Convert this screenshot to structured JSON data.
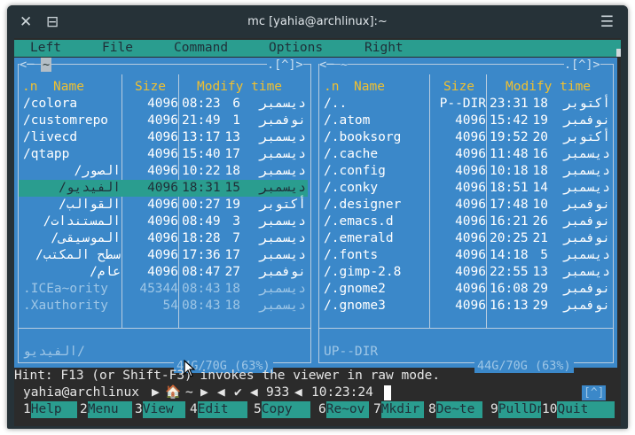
{
  "window": {
    "title": "mc [yahia@archlinux]:~"
  },
  "menu": [
    "Left",
    "File",
    "Command",
    "Options",
    "Right"
  ],
  "left_panel": {
    "path": "~",
    "top_right": ".[^]>",
    "headers": {
      "n": ".n",
      "name": "Name",
      "size": "Size",
      "time": "Modify time"
    },
    "rows": [
      {
        "name": "/colora",
        "size": "4096",
        "time": "08:23",
        "day": "6",
        "month": "ديسمبر"
      },
      {
        "name": "/customrepo",
        "size": "4096",
        "time": "21:49",
        "day": "1",
        "month": "نوفمبر"
      },
      {
        "name": "/livecd",
        "size": "4096",
        "time": "13:17",
        "day": "13",
        "month": "ديسمبر"
      },
      {
        "name": "/qtapp",
        "size": "4096",
        "time": "15:40",
        "day": "17",
        "month": "ديسمبر"
      },
      {
        "name": "الصور/",
        "size": "4096",
        "time": "10:22",
        "day": "18",
        "month": "ديسمبر"
      },
      {
        "name": "الفيديو/",
        "size": "4096",
        "time": "18:31",
        "day": "15",
        "month": "ديسمبر"
      },
      {
        "name": "القوالب/",
        "size": "4096",
        "time": "00:27",
        "day": "19",
        "month": "أكتوبر"
      },
      {
        "name": "المستندات/",
        "size": "4096",
        "time": "08:49",
        "day": "3",
        "month": "ديسمبر"
      },
      {
        "name": "الموسيقى/",
        "size": "4096",
        "time": "18:28",
        "day": "7",
        "month": "ديسمبر"
      },
      {
        "name": "سطح المكتب/",
        "size": "4096",
        "time": "17:36",
        "day": "17",
        "month": "ديسمبر"
      },
      {
        "name": "عام/",
        "size": "4096",
        "time": "08:47",
        "day": "27",
        "month": "نوفمبر"
      },
      {
        "name": ".ICEa~ority",
        "size": "45344",
        "time": "08:43",
        "day": "18",
        "month": "ديسمبر"
      },
      {
        "name": ".Xauthority",
        "size": "54",
        "time": "08:43",
        "day": "18",
        "month": "ديسمبر"
      }
    ],
    "mini_status": "الفيديو/",
    "footer": "44G/70G (63%)"
  },
  "right_panel": {
    "path": "~",
    "top_right": ".[^]>",
    "headers": {
      "n": ".n",
      "name": "Name",
      "size": "Size",
      "time": "Modify time"
    },
    "rows": [
      {
        "name": "/..",
        "size": "P--DIR",
        "time": "23:31",
        "day": "18",
        "month": "أكتوبر"
      },
      {
        "name": "/.atom",
        "size": "4096",
        "time": "15:42",
        "day": "19",
        "month": "نوفمبر"
      },
      {
        "name": "/.booksorg",
        "size": "4096",
        "time": "19:52",
        "day": "20",
        "month": "أكتوبر"
      },
      {
        "name": "/.cache",
        "size": "4096",
        "time": "11:48",
        "day": "16",
        "month": "ديسمبر"
      },
      {
        "name": "/.config",
        "size": "4096",
        "time": "10:18",
        "day": "18",
        "month": "ديسمبر"
      },
      {
        "name": "/.conky",
        "size": "4096",
        "time": "18:51",
        "day": "14",
        "month": "ديسمبر"
      },
      {
        "name": "/.designer",
        "size": "4096",
        "time": "17:48",
        "day": "10",
        "month": "نوفمبر"
      },
      {
        "name": "/.emacs.d",
        "size": "4096",
        "time": "16:21",
        "day": "26",
        "month": "نوفمبر"
      },
      {
        "name": "/.emerald",
        "size": "4096",
        "time": "20:25",
        "day": "21",
        "month": "نوفمبر"
      },
      {
        "name": "/.fonts",
        "size": "4096",
        "time": "14:18",
        "day": "5",
        "month": "ديسمبر"
      },
      {
        "name": "/.gimp-2.8",
        "size": "4096",
        "time": "22:55",
        "day": "13",
        "month": "ديسمبر"
      },
      {
        "name": "/.gnome2",
        "size": "4096",
        "time": "16:08",
        "day": "29",
        "month": "نوفمبر"
      },
      {
        "name": "/.gnome3",
        "size": "4096",
        "time": "16:13",
        "day": "29",
        "month": "نوفمبر"
      }
    ],
    "mini_status": "UP--DIR",
    "footer": "44G/70G (63%)"
  },
  "hint": "Hint: F13 (or Shift-F3) invokes the viewer in raw mode.",
  "prompt": {
    "user": "yahia@archlinux",
    "home": "~",
    "check": "✔",
    "count": "933",
    "clock": "10:23:24",
    "caret": "[^]"
  },
  "fkeys": [
    {
      "num": "1",
      "label": "Help"
    },
    {
      "num": "2",
      "label": "Menu"
    },
    {
      "num": "3",
      "label": "View"
    },
    {
      "num": "4",
      "label": "Edit"
    },
    {
      "num": "5",
      "label": "Copy"
    },
    {
      "num": "6",
      "label": "Re~ov"
    },
    {
      "num": "7",
      "label": "Mkdir"
    },
    {
      "num": "8",
      "label": "De~te"
    },
    {
      "num": "9",
      "label": "PullDn"
    },
    {
      "num": "10",
      "label": "Quit"
    }
  ],
  "colors": {
    "panel": "#3b88c9",
    "accent": "#2a9d8f",
    "header": "#f0c030",
    "terminal_bg": "#2b2b2b"
  }
}
